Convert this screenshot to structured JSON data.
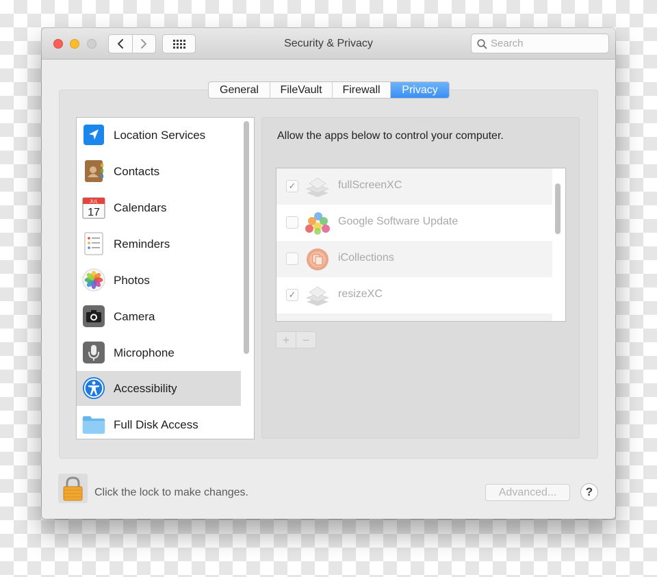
{
  "window": {
    "title": "Security & Privacy"
  },
  "toolbar": {
    "search_placeholder": "Search"
  },
  "tabs": [
    {
      "label": "General",
      "active": false
    },
    {
      "label": "FileVault",
      "active": false
    },
    {
      "label": "Firewall",
      "active": false
    },
    {
      "label": "Privacy",
      "active": true
    }
  ],
  "sidebar": {
    "items": [
      {
        "label": "Location Services",
        "icon": "location-arrow-icon",
        "active": false
      },
      {
        "label": "Contacts",
        "icon": "contacts-book-icon",
        "active": false
      },
      {
        "label": "Calendars",
        "icon": "calendar-icon",
        "active": false
      },
      {
        "label": "Reminders",
        "icon": "reminders-list-icon",
        "active": false
      },
      {
        "label": "Photos",
        "icon": "photos-flower-icon",
        "active": false
      },
      {
        "label": "Camera",
        "icon": "camera-icon",
        "active": false
      },
      {
        "label": "Microphone",
        "icon": "microphone-icon",
        "active": false
      },
      {
        "label": "Accessibility",
        "icon": "accessibility-person-icon",
        "active": true
      },
      {
        "label": "Full Disk Access",
        "icon": "folder-icon",
        "active": false
      }
    ],
    "calendar_icon": {
      "month": "JUL",
      "day": "17"
    }
  },
  "panel": {
    "description": "Allow the apps below to control your computer.",
    "apps": [
      {
        "name": "fullScreenXC",
        "checked": true,
        "icon": "stack-layers-icon"
      },
      {
        "name": "Google Software Update",
        "checked": false,
        "icon": "colored-balls-icon"
      },
      {
        "name": "iCollections",
        "checked": false,
        "icon": "icollections-icon"
      },
      {
        "name": "resizeXC",
        "checked": true,
        "icon": "stack-layers-icon"
      }
    ],
    "add_label": "+",
    "remove_label": "−"
  },
  "footer": {
    "lock_text": "Click the lock to make changes.",
    "advanced_label": "Advanced...",
    "help_label": "?"
  },
  "colors": {
    "accent": "#3b8ff3",
    "close": "#fc5f57",
    "minimize": "#fdbc2e",
    "lock": "#f0a830"
  }
}
